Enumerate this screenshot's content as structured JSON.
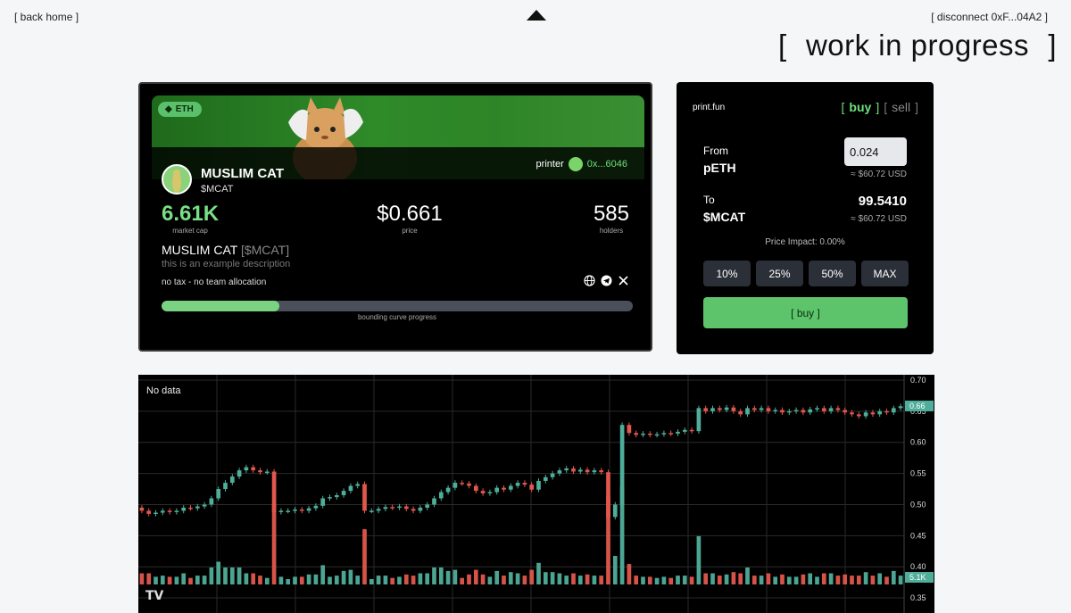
{
  "nav": {
    "back_label": "[ back home ]",
    "disconnect_label": "[ disconnect 0xF...04A2 ]",
    "wip": {
      "open": "[",
      "text": "work in progress",
      "close": "]"
    }
  },
  "token": {
    "chain_badge": "ETH",
    "printer_label": "printer",
    "printer_address": "0x...6046",
    "name": "MUSLIM CAT",
    "ticker": "$MCAT",
    "market_cap": "6.61K",
    "market_cap_label": "market cap",
    "price": "$0.661",
    "price_label": "price",
    "holders": "585",
    "holders_label": "holders",
    "desc_name": "MUSLIM CAT",
    "desc_ticker": "[$MCAT]",
    "description": "this is an example description",
    "tax_info": "no tax - no team allocation",
    "progress": 0.25,
    "progress_label": "bounding curve progress",
    "social_icons": [
      "globe-icon",
      "telegram-icon",
      "x-icon"
    ]
  },
  "trade": {
    "brand": "print.fun",
    "tab_buy": "buy",
    "tab_sell": "sell",
    "from_label": "From",
    "from_token": "pETH",
    "from_value": "0.024",
    "from_usd": "≈ $60.72 USD",
    "to_label": "To",
    "to_token": "$MCAT",
    "to_value": "99.5410",
    "to_usd": "≈ $60.72 USD",
    "price_impact": "Price Impact: 0.00%",
    "pct_buttons": [
      "10%",
      "25%",
      "50%",
      "MAX"
    ],
    "buy_button": "[ buy ]"
  },
  "chart": {
    "no_data": "No data",
    "logo": "TV",
    "colors": {
      "up": "#4fae9a",
      "down": "#e2574c",
      "grid": "#2a2a2a"
    }
  },
  "chart_data": {
    "type": "candlestick",
    "y_ticks": [
      "0.70",
      "0.65",
      "0.60",
      "0.55",
      "0.50",
      "0.45",
      "0.40",
      "0.35"
    ],
    "ylim": [
      0.33,
      0.7
    ],
    "last_price_label": "0.66",
    "last_volume_label": "5.1K",
    "candles": [
      [
        0.495,
        0.49
      ],
      [
        0.49,
        0.485
      ],
      [
        0.485,
        0.487
      ],
      [
        0.487,
        0.49
      ],
      [
        0.49,
        0.488
      ],
      [
        0.488,
        0.49
      ],
      [
        0.49,
        0.495
      ],
      [
        0.495,
        0.494
      ],
      [
        0.494,
        0.497
      ],
      [
        0.497,
        0.5
      ],
      [
        0.5,
        0.51
      ],
      [
        0.51,
        0.525
      ],
      [
        0.525,
        0.535
      ],
      [
        0.535,
        0.545
      ],
      [
        0.545,
        0.555
      ],
      [
        0.555,
        0.56
      ],
      [
        0.56,
        0.555
      ],
      [
        0.555,
        0.552
      ],
      [
        0.552,
        0.553
      ],
      [
        0.553,
        0.488
      ],
      [
        0.488,
        0.49
      ],
      [
        0.49,
        0.49
      ],
      [
        0.49,
        0.492
      ],
      [
        0.492,
        0.49
      ],
      [
        0.49,
        0.494
      ],
      [
        0.494,
        0.498
      ],
      [
        0.498,
        0.51
      ],
      [
        0.51,
        0.512
      ],
      [
        0.512,
        0.515
      ],
      [
        0.515,
        0.522
      ],
      [
        0.522,
        0.53
      ],
      [
        0.53,
        0.533
      ],
      [
        0.533,
        0.49
      ],
      [
        0.49,
        0.49
      ],
      [
        0.49,
        0.493
      ],
      [
        0.493,
        0.496
      ],
      [
        0.496,
        0.495
      ],
      [
        0.495,
        0.497
      ],
      [
        0.497,
        0.493
      ],
      [
        0.493,
        0.49
      ],
      [
        0.49,
        0.495
      ],
      [
        0.495,
        0.5
      ],
      [
        0.5,
        0.51
      ],
      [
        0.51,
        0.52
      ],
      [
        0.52,
        0.527
      ],
      [
        0.527,
        0.535
      ],
      [
        0.535,
        0.534
      ],
      [
        0.534,
        0.53
      ],
      [
        0.53,
        0.522
      ],
      [
        0.522,
        0.518
      ],
      [
        0.518,
        0.52
      ],
      [
        0.52,
        0.527
      ],
      [
        0.527,
        0.524
      ],
      [
        0.524,
        0.53
      ],
      [
        0.53,
        0.535
      ],
      [
        0.535,
        0.532
      ],
      [
        0.532,
        0.524
      ],
      [
        0.524,
        0.538
      ],
      [
        0.538,
        0.544
      ],
      [
        0.544,
        0.55
      ],
      [
        0.55,
        0.555
      ],
      [
        0.555,
        0.558
      ],
      [
        0.558,
        0.553
      ],
      [
        0.553,
        0.556
      ],
      [
        0.556,
        0.552
      ],
      [
        0.552,
        0.555
      ],
      [
        0.555,
        0.552
      ],
      [
        0.552,
        0.48
      ],
      [
        0.48,
        0.5
      ],
      [
        0.5,
        0.628
      ],
      [
        0.628,
        0.615
      ],
      [
        0.615,
        0.612
      ],
      [
        0.612,
        0.614
      ],
      [
        0.614,
        0.612
      ],
      [
        0.612,
        0.613
      ],
      [
        0.613,
        0.615
      ],
      [
        0.615,
        0.614
      ],
      [
        0.614,
        0.617
      ],
      [
        0.617,
        0.62
      ],
      [
        0.62,
        0.618
      ],
      [
        0.618,
        0.655
      ],
      [
        0.655,
        0.65
      ],
      [
        0.65,
        0.655
      ],
      [
        0.655,
        0.652
      ],
      [
        0.652,
        0.656
      ],
      [
        0.656,
        0.65
      ],
      [
        0.65,
        0.645
      ],
      [
        0.645,
        0.655
      ],
      [
        0.655,
        0.652
      ],
      [
        0.652,
        0.655
      ],
      [
        0.655,
        0.65
      ],
      [
        0.65,
        0.652
      ],
      [
        0.652,
        0.648
      ],
      [
        0.648,
        0.65
      ],
      [
        0.65,
        0.652
      ],
      [
        0.652,
        0.648
      ],
      [
        0.648,
        0.653
      ],
      [
        0.653,
        0.655
      ],
      [
        0.655,
        0.65
      ],
      [
        0.65,
        0.655
      ],
      [
        0.655,
        0.652
      ],
      [
        0.652,
        0.648
      ],
      [
        0.648,
        0.645
      ],
      [
        0.645,
        0.642
      ],
      [
        0.642,
        0.648
      ],
      [
        0.648,
        0.645
      ],
      [
        0.645,
        0.65
      ],
      [
        0.65,
        0.648
      ],
      [
        0.648,
        0.655
      ],
      [
        0.655,
        0.658
      ]
    ]
  }
}
